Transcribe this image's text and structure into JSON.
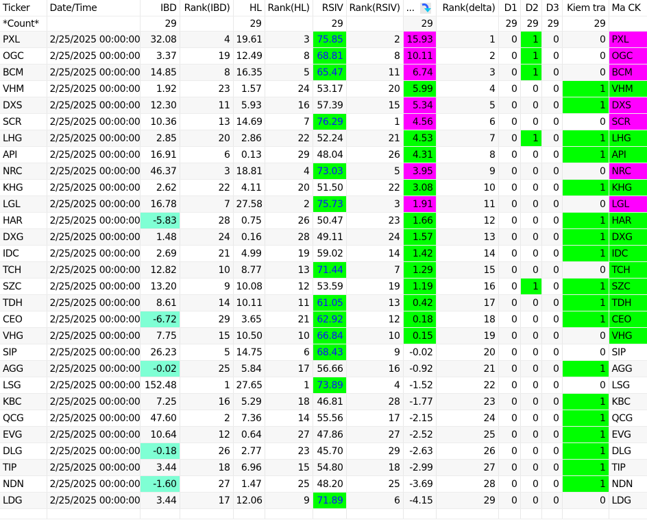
{
  "columns": [
    "Ticker",
    "Date/Time",
    "IBD",
    "Rank(IBD)",
    "HL",
    "Rank(HL)",
    "RSIV",
    "Rank(RSIV)",
    "...",
    "Rank(delta)",
    "D1",
    "D2",
    "D3",
    "Kiem tra",
    "Ma CK"
  ],
  "count_row": [
    "*Count*",
    "",
    "29",
    "",
    "29",
    "",
    "29",
    "",
    "29",
    "",
    "29",
    "29",
    "29",
    "29",
    ""
  ],
  "sort_icon": "sort-descending-icon",
  "colors": {
    "green": "#00ff00",
    "magenta": "#ff00ff",
    "aqua": "#7fffd4",
    "link_blue": "#1010ff"
  },
  "rows": [
    [
      "PXL",
      "2/25/2025 00:00:00",
      "32.08",
      "4",
      "19.61",
      "3",
      "75.85",
      "2",
      "15.93",
      "1",
      "0",
      "1",
      "0",
      "0",
      "PXL",
      "m",
      "m"
    ],
    [
      "OGC",
      "2/25/2025 00:00:00",
      "3.37",
      "19",
      "12.49",
      "8",
      "68.81",
      "8",
      "10.11",
      "2",
      "0",
      "1",
      "0",
      "0",
      "OGC",
      "m",
      "m"
    ],
    [
      "BCM",
      "2/25/2025 00:00:00",
      "14.85",
      "8",
      "16.35",
      "5",
      "65.47",
      "11",
      "6.74",
      "3",
      "0",
      "1",
      "0",
      "0",
      "BCM",
      "m",
      "m"
    ],
    [
      "VHM",
      "2/25/2025 00:00:00",
      "1.92",
      "23",
      "1.57",
      "24",
      "53.17",
      "20",
      "5.99",
      "4",
      "0",
      "0",
      "0",
      "1",
      "VHM",
      "g",
      "g"
    ],
    [
      "DXS",
      "2/25/2025 00:00:00",
      "12.30",
      "11",
      "5.93",
      "16",
      "57.39",
      "15",
      "5.34",
      "5",
      "0",
      "0",
      "0",
      "1",
      "DXS",
      "m",
      "m"
    ],
    [
      "SCR",
      "2/25/2025 00:00:00",
      "10.36",
      "13",
      "14.69",
      "7",
      "76.29",
      "1",
      "4.56",
      "6",
      "0",
      "0",
      "0",
      "0",
      "SCR",
      "m",
      "m"
    ],
    [
      "LHG",
      "2/25/2025 00:00:00",
      "2.85",
      "20",
      "2.86",
      "22",
      "52.24",
      "21",
      "4.53",
      "7",
      "0",
      "1",
      "0",
      "1",
      "LHG",
      "g",
      "g"
    ],
    [
      "API",
      "2/25/2025 00:00:00",
      "16.91",
      "6",
      "0.13",
      "29",
      "48.04",
      "26",
      "4.31",
      "8",
      "0",
      "0",
      "0",
      "1",
      "API",
      "g",
      "g"
    ],
    [
      "NRC",
      "2/25/2025 00:00:00",
      "46.37",
      "3",
      "18.81",
      "4",
      "73.03",
      "5",
      "3.95",
      "9",
      "0",
      "0",
      "0",
      "0",
      "NRC",
      "m",
      "m"
    ],
    [
      "KHG",
      "2/25/2025 00:00:00",
      "2.62",
      "22",
      "4.11",
      "20",
      "51.50",
      "22",
      "3.08",
      "10",
      "0",
      "0",
      "0",
      "1",
      "KHG",
      "g",
      "g"
    ],
    [
      "LGL",
      "2/25/2025 00:00:00",
      "16.78",
      "7",
      "27.58",
      "2",
      "75.73",
      "3",
      "1.91",
      "11",
      "0",
      "0",
      "0",
      "0",
      "LGL",
      "m",
      "m"
    ],
    [
      "HAR",
      "2/25/2025 00:00:00",
      "-5.83",
      "28",
      "0.75",
      "26",
      "50.47",
      "23",
      "1.66",
      "12",
      "0",
      "0",
      "0",
      "1",
      "HAR",
      "g",
      "g"
    ],
    [
      "DXG",
      "2/25/2025 00:00:00",
      "1.48",
      "24",
      "0.16",
      "28",
      "49.11",
      "24",
      "1.57",
      "13",
      "0",
      "0",
      "0",
      "1",
      "DXG",
      "g",
      "g"
    ],
    [
      "IDC",
      "2/25/2025 00:00:00",
      "2.69",
      "21",
      "4.99",
      "19",
      "59.02",
      "14",
      "1.42",
      "14",
      "0",
      "0",
      "0",
      "1",
      "IDC",
      "g",
      "g"
    ],
    [
      "TCH",
      "2/25/2025 00:00:00",
      "12.82",
      "10",
      "8.77",
      "13",
      "71.44",
      "7",
      "1.29",
      "15",
      "0",
      "0",
      "0",
      "0",
      "TCH",
      "g",
      "g"
    ],
    [
      "SZC",
      "2/25/2025 00:00:00",
      "13.20",
      "9",
      "10.08",
      "12",
      "53.59",
      "19",
      "1.19",
      "16",
      "0",
      "1",
      "0",
      "1",
      "SZC",
      "g",
      "g"
    ],
    [
      "TDH",
      "2/25/2025 00:00:00",
      "8.61",
      "14",
      "10.11",
      "11",
      "61.05",
      "13",
      "0.42",
      "17",
      "0",
      "0",
      "0",
      "1",
      "TDH",
      "g",
      "g"
    ],
    [
      "CEO",
      "2/25/2025 00:00:00",
      "-6.72",
      "29",
      "3.65",
      "21",
      "62.92",
      "12",
      "0.18",
      "18",
      "0",
      "0",
      "0",
      "1",
      "CEO",
      "g",
      "g"
    ],
    [
      "VHG",
      "2/25/2025 00:00:00",
      "7.75",
      "15",
      "10.50",
      "10",
      "66.84",
      "10",
      "0.15",
      "19",
      "0",
      "0",
      "0",
      "0",
      "VHG",
      "g",
      "g"
    ],
    [
      "SIP",
      "2/25/2025 00:00:00",
      "26.23",
      "5",
      "14.75",
      "6",
      "68.43",
      "9",
      "-0.02",
      "20",
      "0",
      "0",
      "0",
      "0",
      "SIP",
      "",
      ""
    ],
    [
      "AGG",
      "2/25/2025 00:00:00",
      "-0.02",
      "25",
      "5.84",
      "17",
      "56.66",
      "16",
      "-0.92",
      "21",
      "0",
      "0",
      "0",
      "1",
      "AGG",
      "",
      ""
    ],
    [
      "LSG",
      "2/25/2025 00:00:00",
      "152.48",
      "1",
      "27.65",
      "1",
      "73.89",
      "4",
      "-1.52",
      "22",
      "0",
      "0",
      "0",
      "0",
      "LSG",
      "",
      ""
    ],
    [
      "KBC",
      "2/25/2025 00:00:00",
      "7.25",
      "16",
      "5.29",
      "18",
      "46.81",
      "28",
      "-1.77",
      "23",
      "0",
      "0",
      "0",
      "1",
      "KBC",
      "",
      ""
    ],
    [
      "QCG",
      "2/25/2025 00:00:00",
      "47.60",
      "2",
      "7.36",
      "14",
      "55.56",
      "17",
      "-2.15",
      "24",
      "0",
      "0",
      "0",
      "1",
      "QCG",
      "",
      ""
    ],
    [
      "EVG",
      "2/25/2025 00:00:00",
      "10.64",
      "12",
      "0.64",
      "27",
      "47.86",
      "27",
      "-2.52",
      "25",
      "0",
      "0",
      "0",
      "1",
      "EVG",
      "",
      ""
    ],
    [
      "DLG",
      "2/25/2025 00:00:00",
      "-0.18",
      "26",
      "2.77",
      "23",
      "45.70",
      "29",
      "-2.63",
      "26",
      "0",
      "0",
      "0",
      "1",
      "DLG",
      "",
      ""
    ],
    [
      "TIP",
      "2/25/2025 00:00:00",
      "3.44",
      "18",
      "6.96",
      "15",
      "54.80",
      "18",
      "-2.99",
      "27",
      "0",
      "0",
      "0",
      "1",
      "TIP",
      "",
      ""
    ],
    [
      "NDN",
      "2/25/2025 00:00:00",
      "-1.60",
      "27",
      "1.47",
      "25",
      "48.20",
      "25",
      "-3.69",
      "28",
      "0",
      "0",
      "0",
      "1",
      "NDN",
      "",
      ""
    ],
    [
      "LDG",
      "2/25/2025 00:00:00",
      "3.44",
      "17",
      "12.06",
      "9",
      "71.89",
      "6",
      "-4.15",
      "29",
      "0",
      "0",
      "0",
      "0",
      "LDG",
      "",
      ""
    ]
  ]
}
